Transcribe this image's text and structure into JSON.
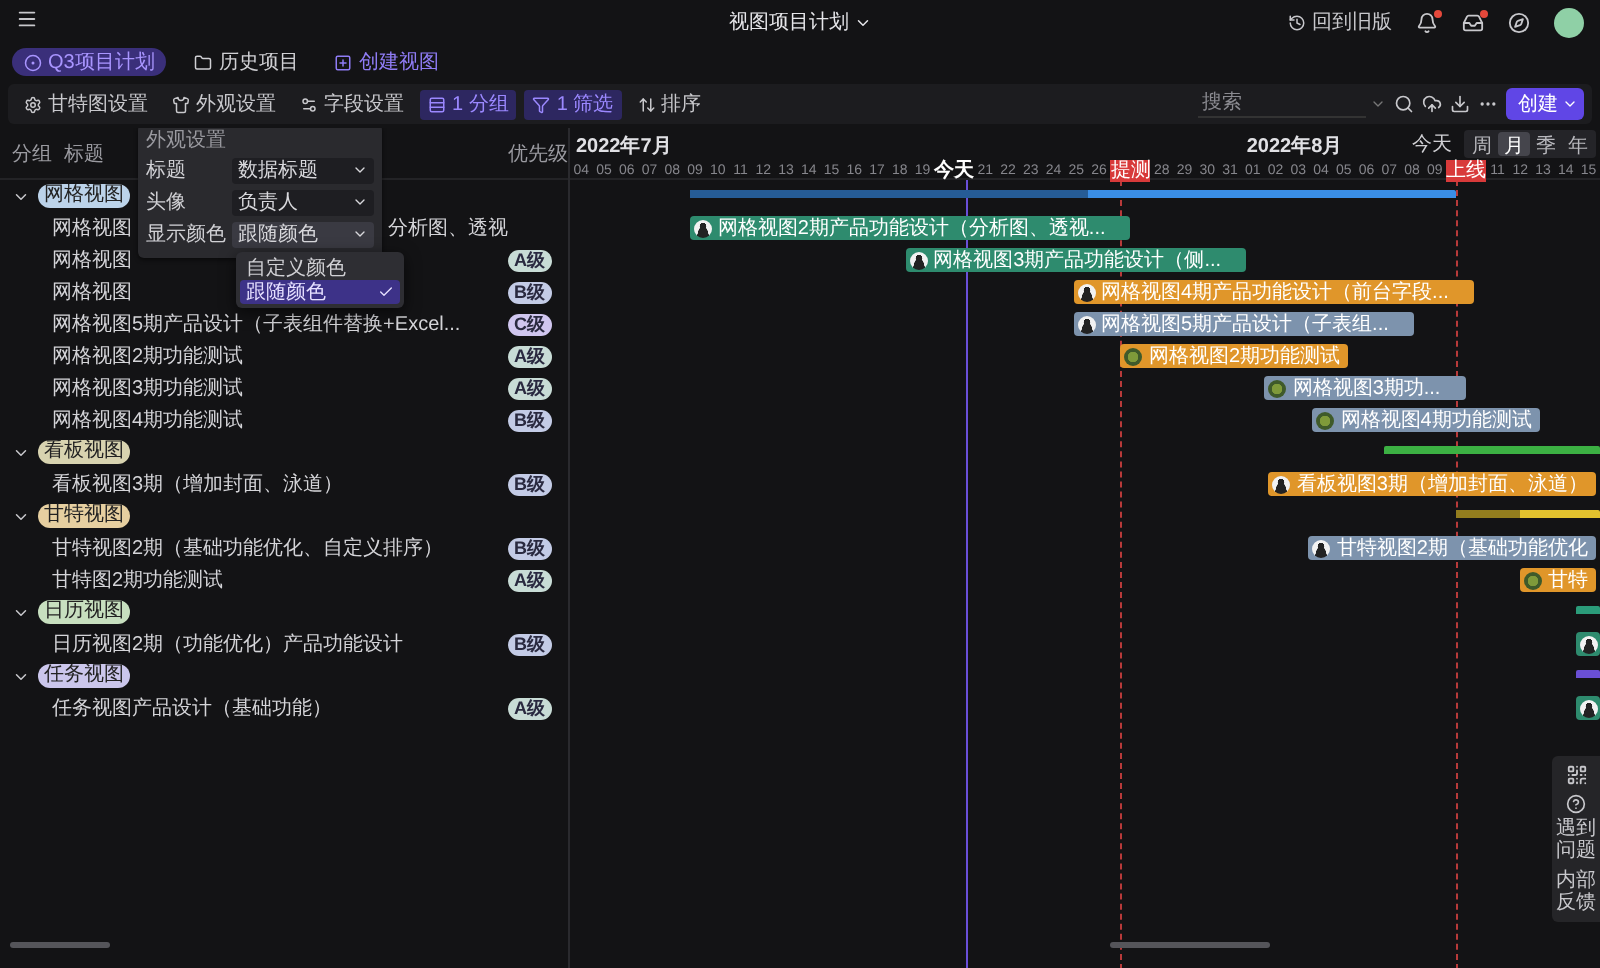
{
  "app": {
    "title": "视图项目计划",
    "legacy_link": "回到旧版"
  },
  "tabs": [
    {
      "label": "Q3项目计划",
      "selected": true
    },
    {
      "label": "历史项目",
      "selected": false
    }
  ],
  "create_view": "创建视图",
  "toolbar": {
    "items": [
      {
        "label": "甘特图设置",
        "active": false
      },
      {
        "label": "外观设置",
        "active": false
      },
      {
        "label": "字段设置",
        "active": false
      },
      {
        "label": "1 分组",
        "active": true
      },
      {
        "label": "1 筛选",
        "active": true
      },
      {
        "label": "排序",
        "active": false
      }
    ],
    "search": {
      "placeholder": "搜索"
    },
    "create_button": "创建"
  },
  "appearance_popup": {
    "title": "外观设置",
    "rows": [
      {
        "label": "标题",
        "value": "数据标题",
        "open": false
      },
      {
        "label": "头像",
        "value": "负责人",
        "open": false
      },
      {
        "label": "显示颜色",
        "value": "跟随颜色",
        "open": true
      }
    ],
    "options": [
      {
        "label": "自定义颜色",
        "selected": false
      },
      {
        "label": "跟随颜色",
        "selected": true
      }
    ]
  },
  "table": {
    "columns": [
      "分组",
      "标题",
      "优先级"
    ],
    "groups": [
      {
        "label": "网格视图",
        "color": "#bcd3ea",
        "expanded": true,
        "summary": {
          "color": "#3a8ee6",
          "level": 0.52
        },
        "tasks": [
          {
            "title": "网格视图",
            "title_tail": "分析图、透视",
            "bar": {
              "label": "网格视图2期产品功能设计（分析图、透视...",
              "color": "#2e8b6e",
              "kind": "person"
            }
          },
          {
            "title": "网格视图",
            "priority": {
              "label": "A级",
              "color": "#c8dcd6"
            },
            "bar": {
              "label": "网格视图3期产品功能设计（侧...",
              "color": "#2e8b6e",
              "kind": "person"
            }
          },
          {
            "title": "网格视图",
            "priority": {
              "label": "B级",
              "color": "#c3cbe6"
            },
            "bar": {
              "label": "网格视图4期产品功能设计（前台字段...",
              "color": "#e0962a",
              "kind": "person"
            }
          },
          {
            "title": "网格视图5期产品设计（子表组件替换+Excel...",
            "priority": {
              "label": "C级",
              "color": "#d0c6ef"
            },
            "bar": {
              "label": "网格视图5期产品设计（子表组...",
              "color": "#7d93ad",
              "kind": "person"
            }
          },
          {
            "title": "网格视图2期功能测试",
            "priority": {
              "label": "A级",
              "color": "#c8dcd6"
            },
            "bar": {
              "label": "网格视图2期功能测试",
              "color": "#e0962a",
              "kind": "emblem"
            }
          },
          {
            "title": "网格视图3期功能测试",
            "priority": {
              "label": "A级",
              "color": "#c8dcd6"
            },
            "bar": {
              "label": "网格视图3期功...",
              "color": "#7d93ad",
              "kind": "emblem"
            }
          },
          {
            "title": "网格视图4期功能测试",
            "priority": {
              "label": "B级",
              "color": "#c3cbe6"
            },
            "bar": {
              "label": "网格视图4期功能测试",
              "color": "#7d93ad",
              "kind": "emblem"
            }
          }
        ]
      },
      {
        "label": "看板视图",
        "color": "#d8d3b0",
        "expanded": true,
        "summary": {
          "color": "#3cb043"
        },
        "tasks": [
          {
            "title": "看板视图3期（增加封面、泳道）",
            "priority": {
              "label": "B级",
              "color": "#c3cbe6"
            },
            "bar": {
              "label": "看板视图3期（增加封面、泳道）",
              "color": "#e0962a",
              "kind": "person"
            }
          }
        ]
      },
      {
        "label": "甘特视图",
        "color": "#e6cfa0",
        "expanded": true,
        "summary": {
          "color": "#e2c12e",
          "level": 0.45
        },
        "tasks": [
          {
            "title": "甘特视图2期（基础功能优化、自定义排序）",
            "priority": {
              "label": "B级",
              "color": "#c3cbe6"
            },
            "bar": {
              "label": "甘特视图2期（基础功能优化",
              "color": "#7d93ad",
              "kind": "person"
            }
          },
          {
            "title": "甘特图2期功能测试",
            "priority": {
              "label": "A级",
              "color": "#c8dcd6"
            },
            "bar": {
              "label": "甘特",
              "color": "#e0962a",
              "kind": "emblem"
            }
          }
        ]
      },
      {
        "label": "日历视图",
        "color": "#c7dfbf",
        "expanded": true,
        "summary": {
          "color": "#2b9c7a"
        },
        "tasks": [
          {
            "title": "日历视图2期（功能优化）产品功能设计",
            "priority": {
              "label": "B级",
              "color": "#c3cbe6"
            },
            "bar": {
              "color": "#2e8b6e",
              "kind": "person"
            }
          }
        ]
      },
      {
        "label": "任务视图",
        "color": "#cbc6ec",
        "expanded": true,
        "summary": {
          "color": "#6a4fd4"
        },
        "tasks": [
          {
            "title": "任务视图产品设计（基础功能）",
            "priority": {
              "label": "A级",
              "color": "#c8dcd6"
            },
            "bar": {
              "color": "#2e8b6e",
              "kind": "person"
            }
          }
        ]
      }
    ]
  },
  "timeline": {
    "months": [
      "2022年7月",
      "2022年8月"
    ],
    "today_button": "今天",
    "scales": [
      {
        "label": "周",
        "selected": false
      },
      {
        "label": "月",
        "selected": true
      },
      {
        "label": "季",
        "selected": false
      },
      {
        "label": "年",
        "selected": false
      }
    ],
    "days": [
      {
        "label": "04",
        "kind": "day"
      },
      {
        "label": "05",
        "kind": "day"
      },
      {
        "label": "06",
        "kind": "day"
      },
      {
        "label": "07",
        "kind": "day"
      },
      {
        "label": "08",
        "kind": "day"
      },
      {
        "label": "09",
        "kind": "day"
      },
      {
        "label": "10",
        "kind": "day"
      },
      {
        "label": "11",
        "kind": "day"
      },
      {
        "label": "12",
        "kind": "day"
      },
      {
        "label": "13",
        "kind": "day"
      },
      {
        "label": "14",
        "kind": "day"
      },
      {
        "label": "15",
        "kind": "day"
      },
      {
        "label": "16",
        "kind": "day"
      },
      {
        "label": "17",
        "kind": "day"
      },
      {
        "label": "18",
        "kind": "day"
      },
      {
        "label": "19",
        "kind": "day"
      },
      {
        "label": "今天",
        "kind": "today"
      },
      {
        "label": "21",
        "kind": "day"
      },
      {
        "label": "22",
        "kind": "day"
      },
      {
        "label": "23",
        "kind": "day"
      },
      {
        "label": "24",
        "kind": "day"
      },
      {
        "label": "25",
        "kind": "day"
      },
      {
        "label": "26",
        "kind": "day"
      },
      {
        "label": "提测",
        "kind": "milestone"
      },
      {
        "label": "28",
        "kind": "day"
      },
      {
        "label": "29",
        "kind": "day"
      },
      {
        "label": "30",
        "kind": "day"
      },
      {
        "label": "31",
        "kind": "day"
      },
      {
        "label": "01",
        "kind": "day"
      },
      {
        "label": "02",
        "kind": "day"
      },
      {
        "label": "03",
        "kind": "day"
      },
      {
        "label": "04",
        "kind": "day"
      },
      {
        "label": "05",
        "kind": "day"
      },
      {
        "label": "06",
        "kind": "day"
      },
      {
        "label": "07",
        "kind": "day"
      },
      {
        "label": "08",
        "kind": "day"
      },
      {
        "label": "09",
        "kind": "day"
      },
      {
        "label": "上线",
        "kind": "milestone"
      },
      {
        "label": "11",
        "kind": "day"
      },
      {
        "label": "12",
        "kind": "day"
      },
      {
        "label": "13",
        "kind": "day"
      },
      {
        "label": "14",
        "kind": "day"
      },
      {
        "label": "15",
        "kind": "day"
      }
    ]
  },
  "help_panel": {
    "items": [
      "遇到问题",
      "内部反馈"
    ]
  }
}
